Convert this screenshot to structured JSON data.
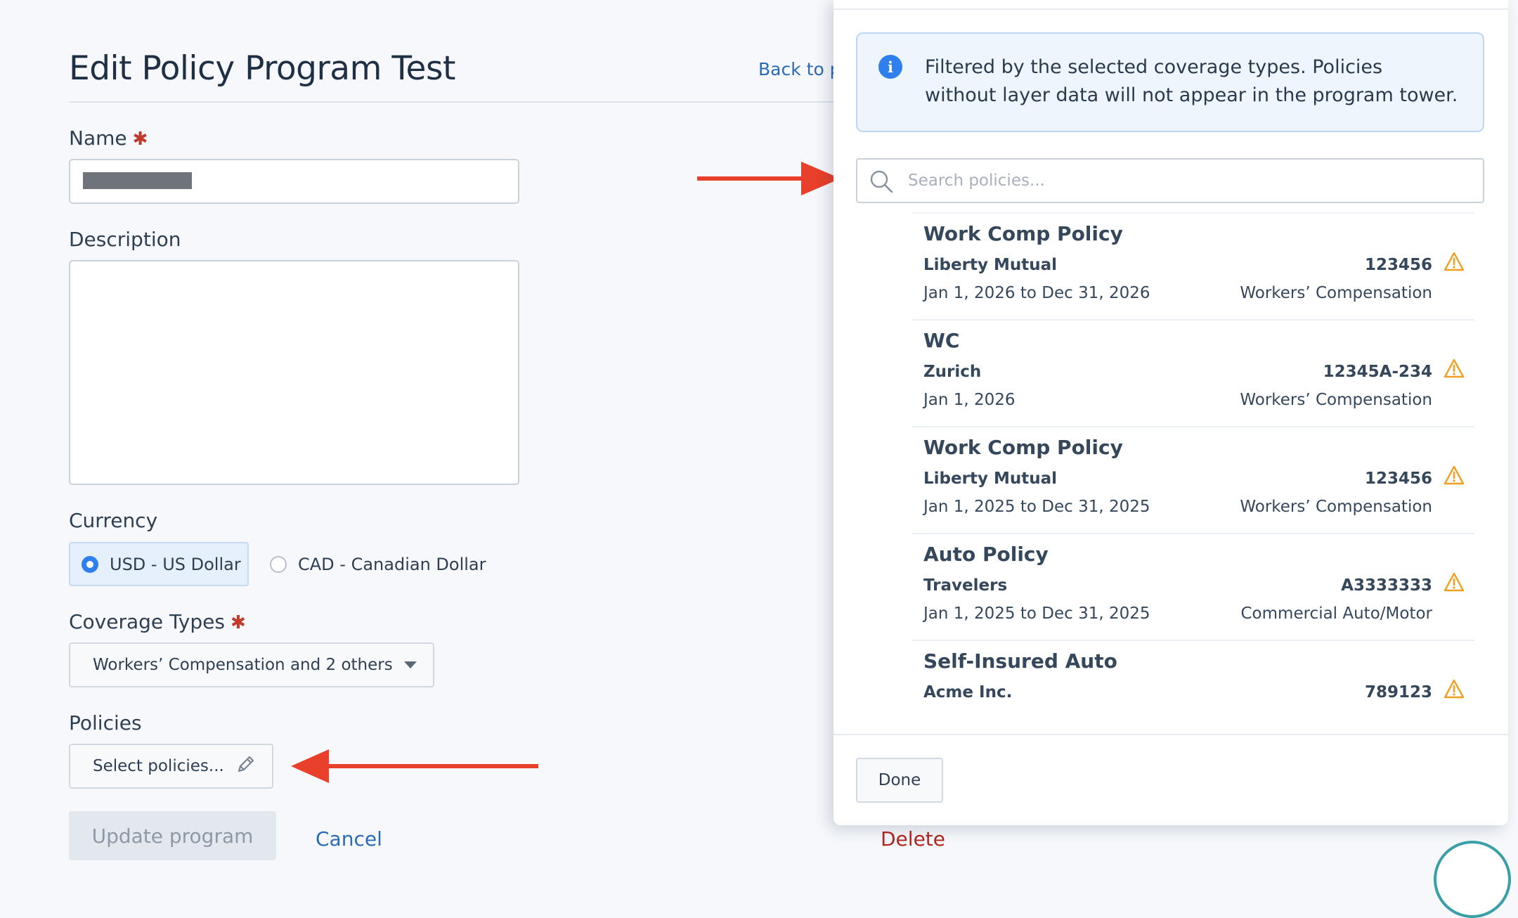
{
  "page": {
    "title": "Edit Policy Program Test",
    "back_link": "Back to p"
  },
  "form": {
    "name_label": "Name",
    "required_mark": "✱",
    "description_label": "Description",
    "currency_label": "Currency",
    "currency_options": [
      {
        "label": "USD - US Dollar",
        "selected": true
      },
      {
        "label": "CAD - Canadian Dollar",
        "selected": false
      }
    ],
    "coverage_label": "Coverage Types",
    "coverage_value": "Workers’ Compensation and 2 others",
    "policies_label": "Policies",
    "select_policies_label": "Select policies...",
    "update_button": "Update program",
    "cancel_link": "Cancel",
    "delete_link": "Delete"
  },
  "panel": {
    "info_text": "Filtered by the selected coverage types. Policies without layer data will not appear in the program tower.",
    "search_placeholder": "Search policies...",
    "done_button": "Done",
    "policies": [
      {
        "name": "Work Comp Policy",
        "carrier": "Liberty Mutual",
        "number": "123456",
        "dates": "Jan 1, 2026 to Dec 31, 2026",
        "coverage": "Workers’ Compensation"
      },
      {
        "name": "WC",
        "carrier": "Zurich",
        "number": "12345A-234",
        "dates": "Jan 1, 2026",
        "coverage": "Workers’ Compensation"
      },
      {
        "name": "Work Comp Policy",
        "carrier": "Liberty Mutual",
        "number": "123456",
        "dates": "Jan 1, 2025 to Dec 31, 2025",
        "coverage": "Workers’ Compensation"
      },
      {
        "name": "Auto Policy",
        "carrier": "Travelers",
        "number": "A3333333",
        "dates": "Jan 1, 2025 to Dec 31, 2025",
        "coverage": "Commercial Auto/Motor"
      },
      {
        "name": "Self-Insured Auto",
        "carrier": "Acme Inc.",
        "number": "789123",
        "dates": "",
        "coverage": ""
      }
    ]
  },
  "colors": {
    "accent": "#2f80ed",
    "link": "#2a6bb8",
    "danger": "#b3261e",
    "warning": "#f0a020",
    "annotation_arrow": "#e8402a"
  },
  "icons": {
    "info": "info-icon",
    "search": "search-icon",
    "warning": "warning-icon",
    "pencil": "pencil-icon",
    "caret": "chevron-down-icon"
  }
}
